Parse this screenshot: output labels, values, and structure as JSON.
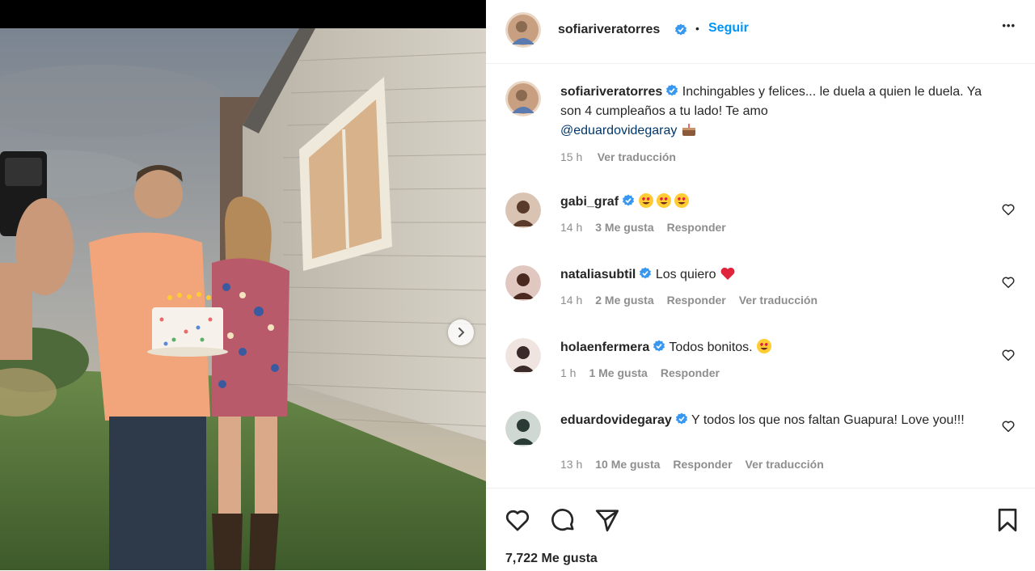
{
  "post": {
    "username": "sofiariveratorres",
    "follow_label": "Seguir",
    "separator": "•",
    "more_label": "•••",
    "caption": "Inchingables y felices... le duela a quien le duela. Ya son 4 cumpleaños a tu lado! Te amo",
    "caption_mention": "@eduardovidegaray",
    "caption_time": "15 h",
    "caption_translate": "Ver traducción"
  },
  "comments": [
    {
      "username": "gabi_graf",
      "text": "",
      "emoji": [
        "heart-eyes",
        "heart-eyes",
        "heart-eyes"
      ],
      "time": "14 h",
      "likes": "3 Me gusta",
      "reply": "Responder",
      "translate": ""
    },
    {
      "username": "nataliasubtil",
      "text": "Los quiero",
      "emoji": [
        "red-heart"
      ],
      "time": "14 h",
      "likes": "2 Me gusta",
      "reply": "Responder",
      "translate": "Ver traducción"
    },
    {
      "username": "holaenfermera",
      "text": "Todos bonitos.",
      "emoji": [
        "heart-eyes"
      ],
      "time": "1 h",
      "likes": "1 Me gusta",
      "reply": "Responder",
      "translate": ""
    },
    {
      "username": "eduardovidegaray",
      "text": "Y todos los que nos faltan Guapura! Love you!!!",
      "emoji": [],
      "time": "13 h",
      "likes": "10 Me gusta",
      "reply": "Responder",
      "translate": "Ver traducción"
    }
  ],
  "footer": {
    "likes_count": "7,722 Me gusta"
  },
  "colors": {
    "accent": "#0095f6",
    "verified": "#3897f0",
    "muted": "#8e8e8e",
    "text": "#262626"
  }
}
